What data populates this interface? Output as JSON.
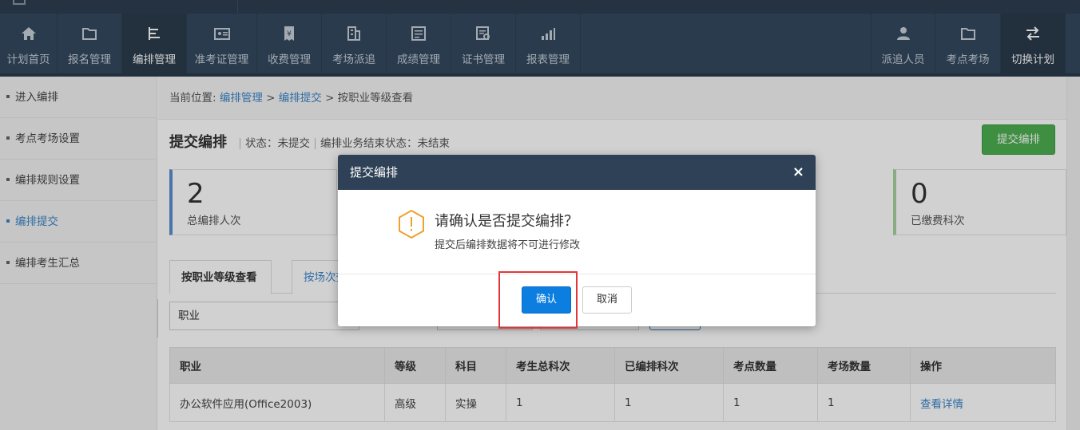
{
  "nav": {
    "items": [
      {
        "label": "计划首页",
        "icon": "home-icon"
      },
      {
        "label": "报名管理",
        "icon": "folder-icon"
      },
      {
        "label": "编排管理",
        "icon": "align-left-icon"
      },
      {
        "label": "准考证管理",
        "icon": "id-card-icon"
      },
      {
        "label": "收费管理",
        "icon": "yen-receipt-icon"
      },
      {
        "label": "考场派追",
        "icon": "building-icon"
      },
      {
        "label": "成绩管理",
        "icon": "score-sheet-icon"
      },
      {
        "label": "证书管理",
        "icon": "certificate-icon"
      },
      {
        "label": "报表管理",
        "icon": "bar-chart-icon"
      }
    ],
    "right_items": [
      {
        "label": "派追人员",
        "icon": "user-icon"
      },
      {
        "label": "考点考场",
        "icon": "folder-icon"
      },
      {
        "label": "切换计划",
        "icon": "swap-icon"
      }
    ]
  },
  "sidebar": {
    "items": [
      {
        "label": "进入编排"
      },
      {
        "label": "考点考场设置"
      },
      {
        "label": "编排规则设置"
      },
      {
        "label": "编排提交"
      },
      {
        "label": "编排考生汇总"
      }
    ]
  },
  "breadcrumb": {
    "prefix": "当前位置:",
    "link1": "编排管理",
    "sep1": ">",
    "link2": "编排提交",
    "sep2": ">",
    "current": "按职业等级查看"
  },
  "page": {
    "title": "提交编排",
    "status": "状态：未提交",
    "end_status": "编排业务结束状态：未结束",
    "submit_label": "提交编排"
  },
  "stats": {
    "left": {
      "value": "2",
      "caption": "总编排人次"
    },
    "right": {
      "value": "0",
      "caption": "已缴费科次"
    }
  },
  "tabs": {
    "active": "按职业等级查看",
    "other": "按场次查"
  },
  "filter": {
    "value": "职业"
  },
  "table": {
    "headers": [
      "职业",
      "等级",
      "科目",
      "考生总科次",
      "已编排科次",
      "考点数量",
      "考场数量",
      "操作"
    ],
    "rows": [
      [
        "办公软件应用(Office2003)",
        "高级",
        "实操",
        "1",
        "1",
        "1",
        "1",
        "查看详情"
      ]
    ]
  },
  "modal": {
    "title": "提交编排",
    "close": "×",
    "message": "请确认是否提交编排？",
    "sub": "提交后编排数据将不可进行修改",
    "ok_label": "确认",
    "cancel_label": "取消",
    "icon": "warning-hexagon-icon"
  },
  "colors": {
    "nav_bg": "#34495e",
    "accent_blue": "#0c7ee0",
    "submit_green": "#4caf50",
    "highlight_red": "#e0383a",
    "warning_orange": "#f0a030"
  }
}
